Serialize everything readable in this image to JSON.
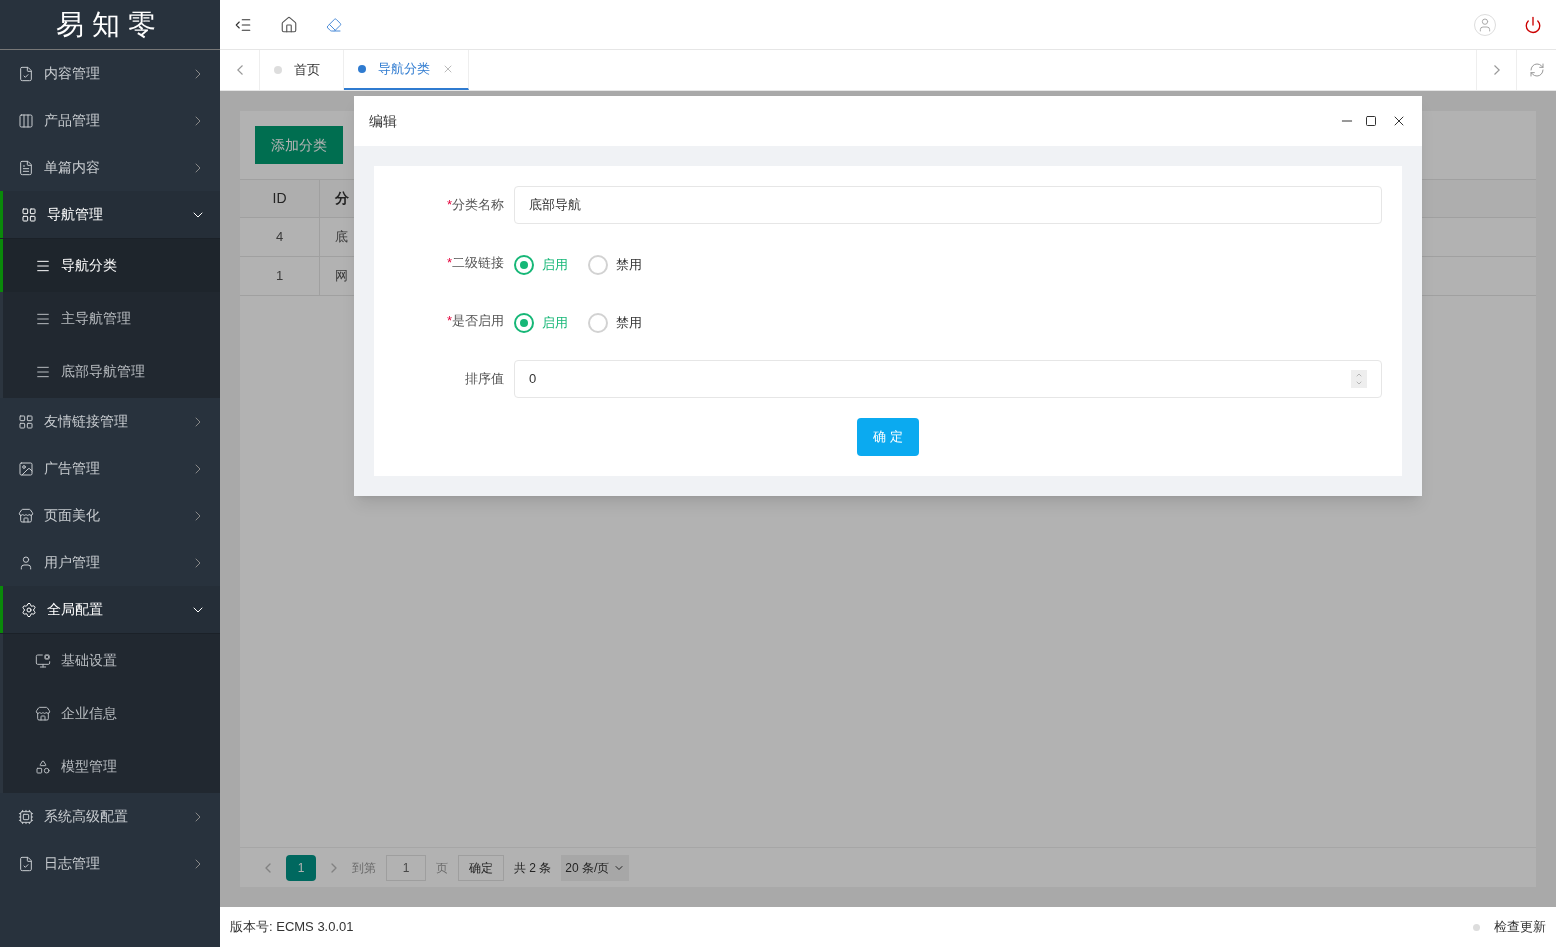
{
  "logo": {
    "text": "易知零"
  },
  "sidebar": {
    "items": [
      {
        "label": "内容管理",
        "expanded": false
      },
      {
        "label": "产品管理",
        "expanded": false
      },
      {
        "label": "单篇内容",
        "expanded": false
      },
      {
        "label": "导航管理",
        "expanded": true,
        "children": [
          {
            "label": "导航分类",
            "selected": true
          },
          {
            "label": "主导航管理",
            "selected": false
          },
          {
            "label": "底部导航管理",
            "selected": false
          }
        ]
      },
      {
        "label": "友情链接管理",
        "expanded": false
      },
      {
        "label": "广告管理",
        "expanded": false
      },
      {
        "label": "页面美化",
        "expanded": false
      },
      {
        "label": "用户管理",
        "expanded": false
      },
      {
        "label": "全局配置",
        "expanded": true,
        "children": [
          {
            "label": "基础设置",
            "selected": false
          },
          {
            "label": "企业信息",
            "selected": false
          },
          {
            "label": "模型管理",
            "selected": false
          }
        ]
      },
      {
        "label": "系统高级配置",
        "expanded": false
      },
      {
        "label": "日志管理",
        "expanded": false
      }
    ]
  },
  "tabs": [
    {
      "label": "首页",
      "selected": false,
      "closable": false
    },
    {
      "label": "导航分类",
      "selected": true,
      "closable": true
    }
  ],
  "page": {
    "add_button": "添加分类",
    "table": {
      "columns": [
        "ID",
        "分"
      ],
      "rows": [
        [
          "4",
          "底"
        ],
        [
          "1",
          "网"
        ]
      ]
    },
    "pagination": {
      "pages": [
        {
          "label": "1",
          "selected": true
        }
      ],
      "goto_label": "到第",
      "goto_value": "1",
      "page_unit": "页",
      "confirm": "确定",
      "total": "共 2 条",
      "page_size": "20 条/页"
    }
  },
  "dialog": {
    "title": "编辑",
    "fields": [
      {
        "kind": "text",
        "label": "分类名称",
        "required_mark": "*",
        "value": "底部导航"
      },
      {
        "kind": "radio",
        "label": "二级链接",
        "required_mark": "*",
        "options": [
          {
            "label": "启用",
            "selected": true
          },
          {
            "label": "禁用",
            "selected": false
          }
        ]
      },
      {
        "kind": "radio",
        "label": "是否启用",
        "required_mark": "*",
        "options": [
          {
            "label": "启用",
            "selected": true
          },
          {
            "label": "禁用",
            "selected": false
          }
        ]
      },
      {
        "kind": "number",
        "label": "排序值",
        "value": "0"
      }
    ],
    "submit": "确 定"
  },
  "footer": {
    "version": "版本号: ECMS 3.0.01",
    "update": "检查更新"
  }
}
